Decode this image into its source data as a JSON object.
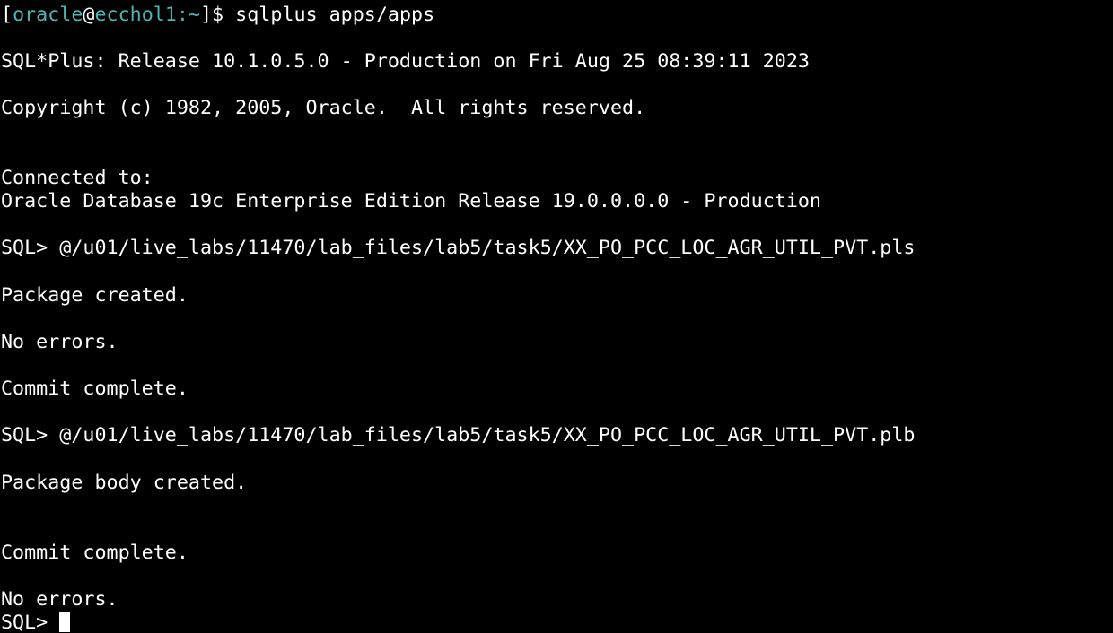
{
  "terminal": {
    "colors": {
      "background": "#000000",
      "foreground": "#ffffff",
      "prompt_user_host": "#4fb3b3"
    },
    "scroll_remnant": "-------------------------------------------------------------------------------------------------------------",
    "prompt": {
      "open_bracket": "[",
      "user": "oracle",
      "at": "@",
      "host": "ecchol1",
      "path": ":~",
      "close": "]$ ",
      "command": "sqlplus apps/apps"
    },
    "lines": [
      "SQL*Plus: Release 10.1.0.5.0 - Production on Fri Aug 25 08:39:11 2023",
      "Copyright (c) 1982, 2005, Oracle.  All rights reserved.",
      "Connected to:",
      "Oracle Database 19c Enterprise Edition Release 19.0.0.0.0 - Production",
      "SQL> @/u01/live_labs/11470/lab_files/lab5/task5/XX_PO_PCC_LOC_AGR_UTIL_PVT.pls",
      "Package created.",
      "No errors.",
      "Commit complete.",
      "SQL> @/u01/live_labs/11470/lab_files/lab5/task5/XX_PO_PCC_LOC_AGR_UTIL_PVT.plb",
      "Package body created.",
      "Commit complete.",
      "No errors."
    ],
    "final_prompt": "SQL> "
  }
}
